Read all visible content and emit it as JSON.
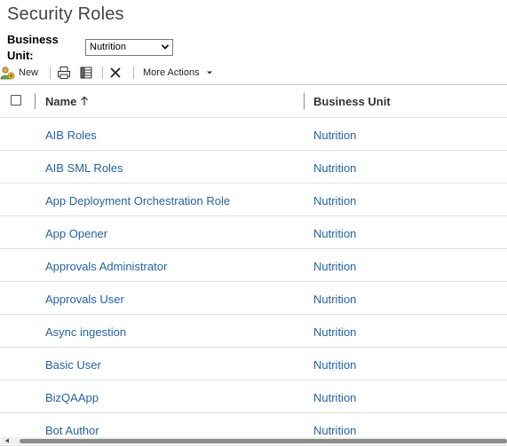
{
  "page": {
    "title": "Security Roles"
  },
  "business_unit": {
    "label_line1": "Business",
    "label_line2": "Unit:",
    "selected": "Nutrition"
  },
  "toolbar": {
    "new_label": "New",
    "more_actions_label": "More Actions",
    "icons": [
      "new-role-icon",
      "print-icon",
      "export-icon",
      "delete-icon",
      "chevron-down-icon"
    ]
  },
  "grid": {
    "columns": [
      {
        "label": "Name",
        "sort": "ascending"
      },
      {
        "label": "Business Unit"
      }
    ],
    "rows": [
      {
        "name": "AIB Roles",
        "business_unit": "Nutrition"
      },
      {
        "name": "AIB SML Roles",
        "business_unit": "Nutrition"
      },
      {
        "name": "App Deployment Orchestration Role",
        "business_unit": "Nutrition"
      },
      {
        "name": "App Opener",
        "business_unit": "Nutrition"
      },
      {
        "name": "Approvals Administrator",
        "business_unit": "Nutrition"
      },
      {
        "name": "Approvals User",
        "business_unit": "Nutrition"
      },
      {
        "name": "Async ingestion",
        "business_unit": "Nutrition"
      },
      {
        "name": "Basic User",
        "business_unit": "Nutrition"
      },
      {
        "name": "BizQAApp",
        "business_unit": "Nutrition"
      },
      {
        "name": "Bot Author",
        "business_unit": "Nutrition"
      }
    ]
  },
  "colors": {
    "link": "#2262a8",
    "title": "#444444",
    "row_border": "#e1e1e1"
  }
}
